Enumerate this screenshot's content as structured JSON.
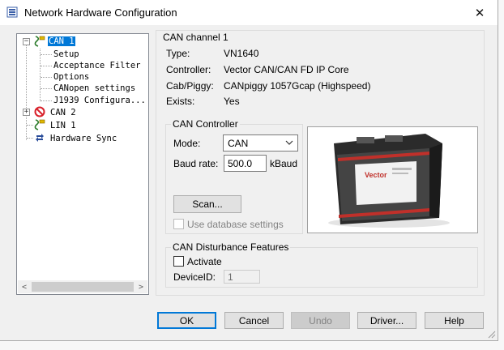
{
  "window": {
    "title": "Network Hardware Configuration",
    "close_glyph": "✕"
  },
  "tree": {
    "can1": {
      "label": "CAN 1",
      "expander": "−"
    },
    "children": [
      {
        "label": "Setup"
      },
      {
        "label": "Acceptance Filter"
      },
      {
        "label": "Options"
      },
      {
        "label": "CANopen settings"
      },
      {
        "label": "J1939 Configura..."
      }
    ],
    "can2": {
      "label": "CAN 2",
      "expander": "+"
    },
    "lin1": {
      "label": "LIN 1"
    },
    "hwsync": {
      "label": "Hardware Sync"
    },
    "scroll_left": "<",
    "scroll_right": ">"
  },
  "channel": {
    "group_title": "CAN channel 1",
    "type_label": "Type:",
    "type_value": "VN1640",
    "controller_label": "Controller:",
    "controller_value": "Vector CAN/CAN FD IP Core",
    "piggy_label": "Cab/Piggy:",
    "piggy_value": "CANpiggy 1057Gcap (Highspeed)",
    "exists_label": "Exists:",
    "exists_value": "Yes"
  },
  "controller": {
    "group_title": "CAN Controller",
    "mode_label": "Mode:",
    "mode_value": "CAN",
    "baud_label": "Baud rate:",
    "baud_value": "500.0",
    "baud_unit": "kBaud",
    "scan_label": "Scan...",
    "db_label": "Use database settings"
  },
  "disturbance": {
    "group_title": "CAN Disturbance Features",
    "activate_label": "Activate",
    "device_label": "DeviceID:",
    "device_value": "1"
  },
  "device_image": {
    "brand": "Vector"
  },
  "buttons": {
    "ok": "OK",
    "cancel": "Cancel",
    "undo": "Undo",
    "driver": "Driver...",
    "help": "Help"
  }
}
